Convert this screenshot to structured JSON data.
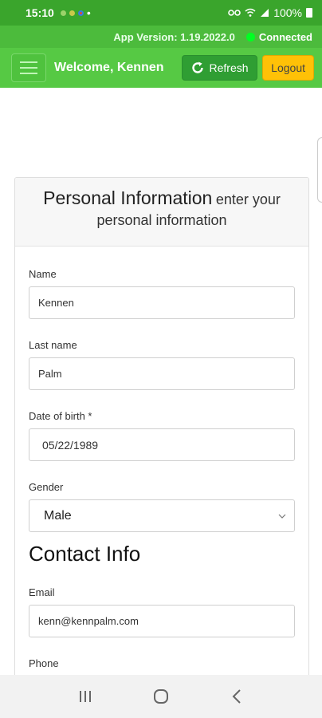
{
  "status_bar": {
    "time": "15:10",
    "battery": "100%",
    "notification_dot": "•"
  },
  "version_bar": {
    "app_version": "App Version: 1.19.2022.0",
    "connection_status": "Connected",
    "connection_color": "#00ff22"
  },
  "navbar": {
    "welcome": "Welcome, Kennen",
    "refresh_label": "Refresh",
    "logout_label": "Logout",
    "brand_green": "#56c944",
    "logout_color": "#ffc107"
  },
  "card": {
    "title": "Personal Information",
    "subtitle_line1": "enter your",
    "subtitle_line2": "personal information"
  },
  "form": {
    "name_label": "Name",
    "name_value": "Kennen",
    "last_name_label": "Last name",
    "last_name_value": "Palm",
    "dob_label": "Date of birth *",
    "dob_value": "05/22/1989",
    "gender_label": "Gender",
    "gender_value": "Male",
    "contact_section": "Contact Info",
    "email_label": "Email",
    "email_value": "kenn@kennpalm.com",
    "phone_label": "Phone"
  },
  "icons": {
    "refresh": "refresh-icon",
    "menu": "hamburger-menu-icon",
    "select_chevron": "chevron-down-icon",
    "nav_recents": "recents-icon",
    "nav_home": "home-icon",
    "nav_back": "back-icon"
  }
}
